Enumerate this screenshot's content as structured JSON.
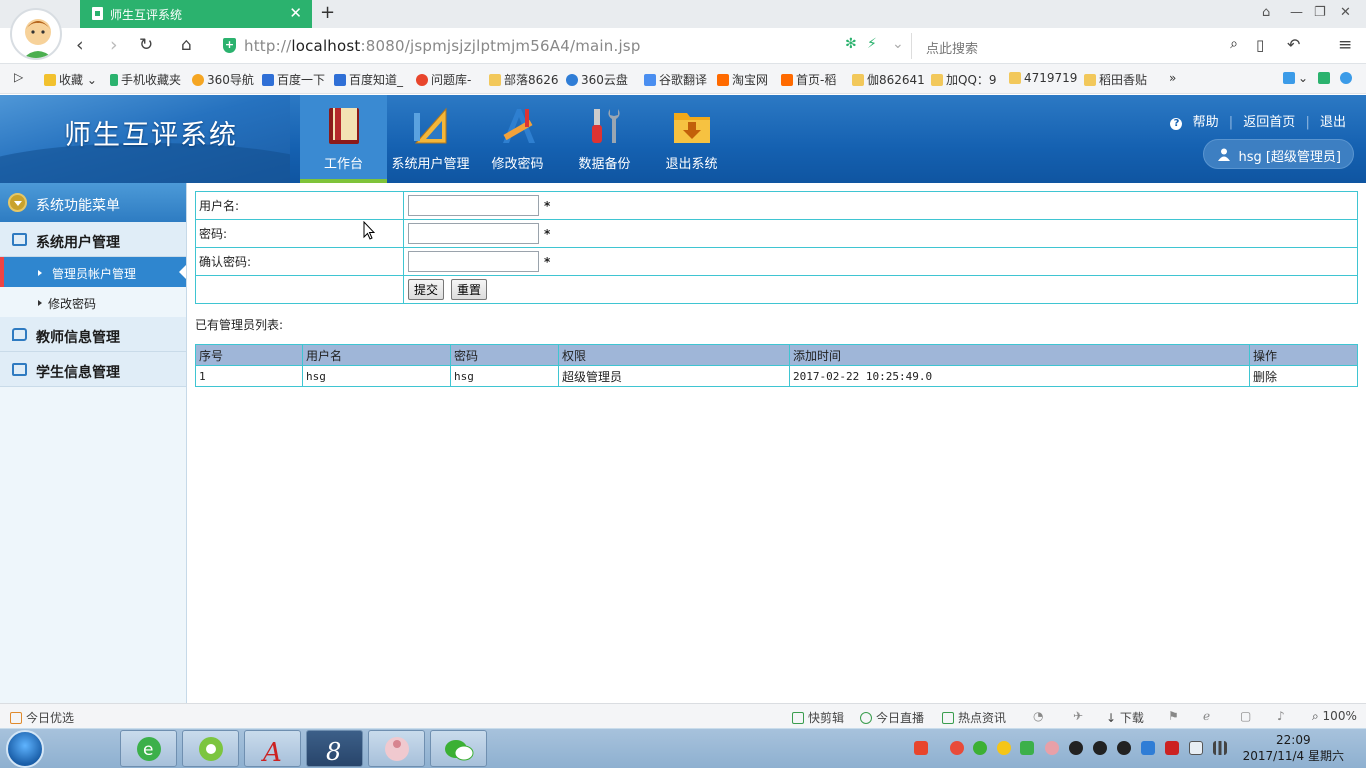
{
  "browser": {
    "tab_title": "师生互评系统",
    "tab_close": "✕",
    "new_tab": "+",
    "url_prefix": "http://",
    "url_host": "localhost",
    "url_rest": ":8080/jspmjsjzjlptmjm56A4/main.jsp",
    "search_placeholder": "点此搜索",
    "bookmarks": [
      "收藏",
      "手机收藏夹",
      "360导航",
      "百度一下",
      "百度知道_",
      "问题库-",
      "部落8626",
      "360云盘",
      "谷歌翻译",
      "淘宝网",
      "首页-稻",
      "伽862641",
      "加QQ：9",
      "4719719",
      "稻田香贴"
    ],
    "more": "»"
  },
  "header": {
    "title": "师生互评系统",
    "nav": [
      "工作台",
      "系统用户管理",
      "修改密码",
      "数据备份",
      "退出系统"
    ],
    "links": {
      "help": "帮助",
      "home": "返回首页",
      "logout": "退出"
    },
    "user": "hsg [超级管理员]"
  },
  "sidebar": {
    "title": "系统功能菜单",
    "sections": [
      {
        "label": "系统用户管理",
        "items": [
          "管理员帐户管理",
          "修改密码"
        ]
      },
      {
        "label": "教师信息管理"
      },
      {
        "label": "学生信息管理"
      }
    ]
  },
  "form": {
    "username_label": "用户名:",
    "password_label": "密码:",
    "confirm_label": "确认密码:",
    "required": "*",
    "submit": "提交",
    "reset": "重置"
  },
  "list": {
    "label": "已有管理员列表:",
    "headers": [
      "序号",
      "用户名",
      "密码",
      "权限",
      "添加时间",
      "操作"
    ],
    "rows": [
      [
        "1",
        "hsg",
        "hsg",
        "超级管理员",
        "2017-02-22 10:25:49.0",
        "删除"
      ]
    ]
  },
  "statusbar": {
    "left": "今日优选",
    "items": [
      "快剪辑",
      "今日直播",
      "热点资讯"
    ],
    "download": "下载",
    "zoom": "100%"
  },
  "taskbar": {
    "time": "22:09",
    "date": "2017/11/4 星期六"
  },
  "colors": {
    "header_blue": "#1561b1",
    "border_cyan": "#3fc5d2",
    "table_head": "#9fb6d8",
    "tab_green": "#2bb26e"
  }
}
